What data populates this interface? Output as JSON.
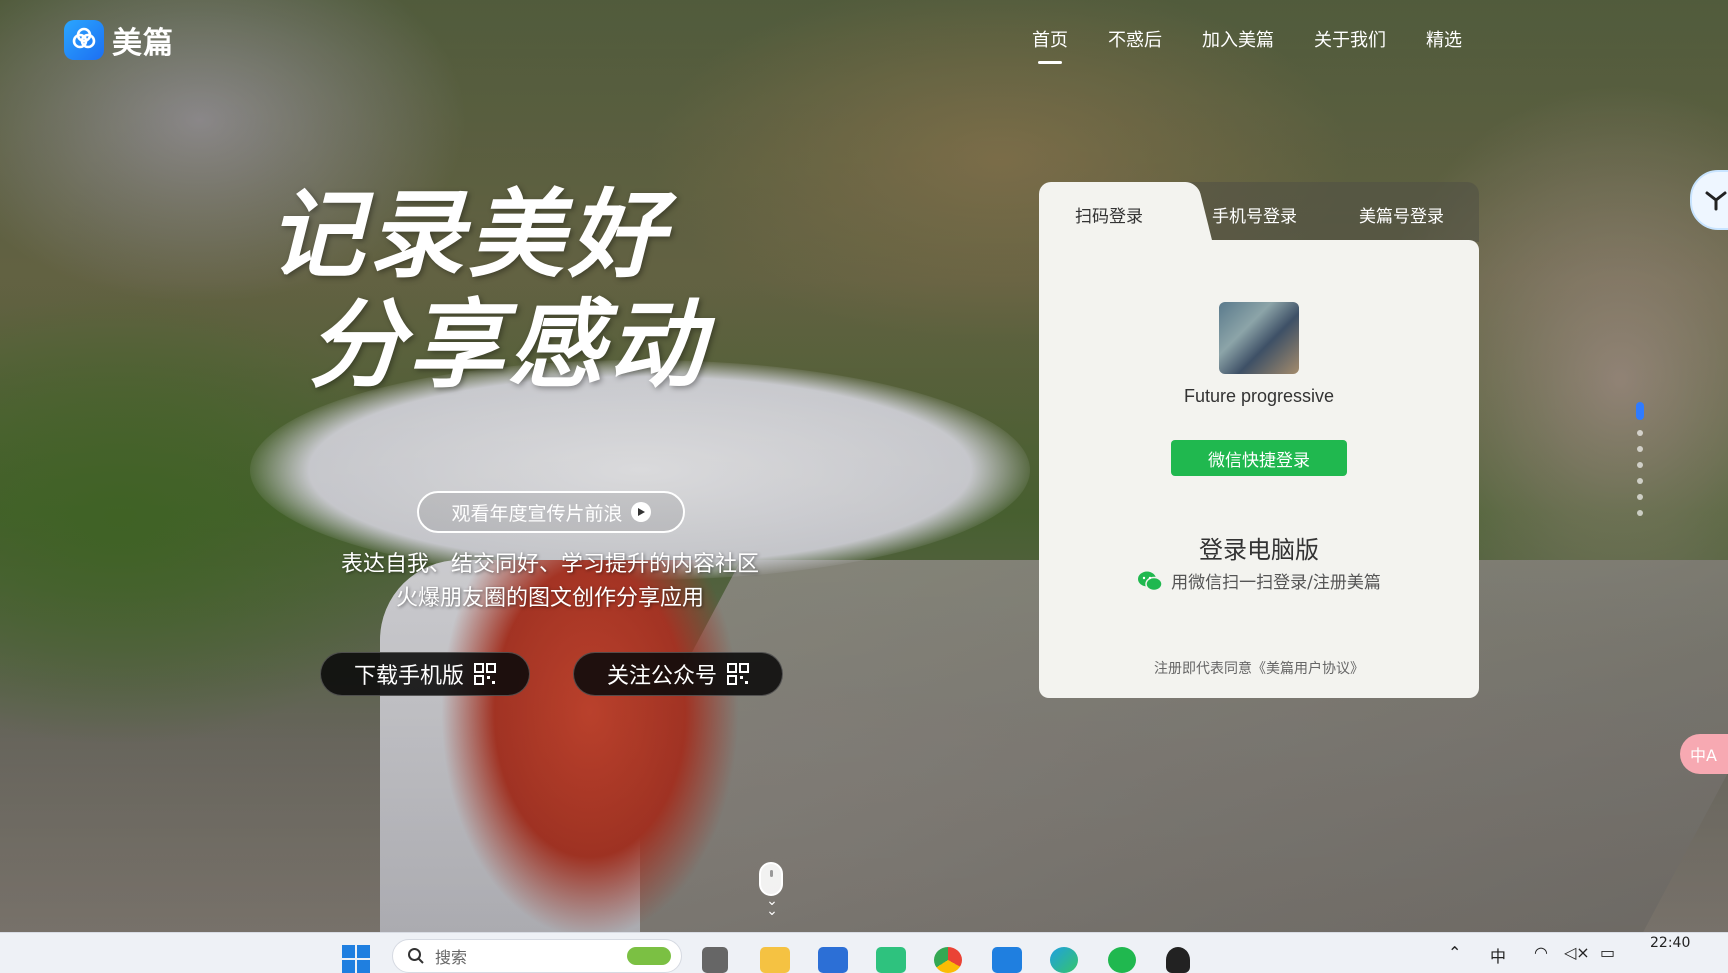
{
  "site": {
    "logo_text": "美篇"
  },
  "nav": {
    "items": [
      {
        "label": "首页",
        "active": true
      },
      {
        "label": "不惑后",
        "active": false
      },
      {
        "label": "加入美篇",
        "active": false
      },
      {
        "label": "关于我们",
        "active": false
      },
      {
        "label": "精选",
        "active": false
      }
    ]
  },
  "hero": {
    "slogan_line1": "记录美好",
    "slogan_line2": "分享感动",
    "promo_button": "观看年度宣传片前浪",
    "tagline_line1": "表达自我、结交同好、学习提升的内容社区",
    "tagline_line2": "火爆朋友圈的图文创作分享应用",
    "download_button": "下载手机版",
    "follow_button": "关注公众号"
  },
  "login": {
    "tabs": [
      {
        "label": "扫码登录",
        "active": true
      },
      {
        "label": "手机号登录",
        "active": false
      },
      {
        "label": "美篇号登录",
        "active": false
      }
    ],
    "username": "Future progressive",
    "wechat_button": "微信快捷登录",
    "pc_title": "登录电脑版",
    "pc_subtitle": "用微信扫一扫登录/注册美篇",
    "agreement": "注册即代表同意《美篇用户协议》"
  },
  "side": {
    "translate_label": "中A"
  },
  "taskbar": {
    "search_placeholder": "搜索",
    "ime": "中",
    "clock_time": "22:40",
    "accent": "#1f7fe0"
  },
  "colors": {
    "wechat_green": "#20b84f",
    "brand_blue": "#1d6ff2",
    "page_dot_active": "#2f7bff"
  }
}
